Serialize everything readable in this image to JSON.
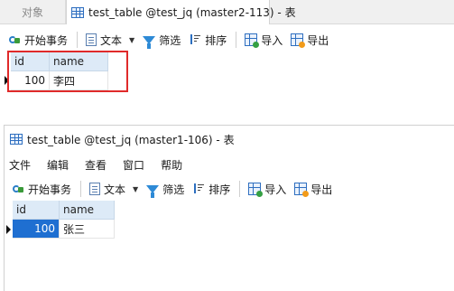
{
  "tabs": {
    "objects_label": "对象",
    "active_tab_label": "test_table @test_jq (master2-113) - 表"
  },
  "toolbar": {
    "begin_transaction": "开始事务",
    "text": "文本",
    "filter": "筛选",
    "sort": "排序",
    "import": "导入",
    "export": "导出"
  },
  "grid1": {
    "columns": [
      "id",
      "name"
    ],
    "rows": [
      [
        "100",
        "李四"
      ]
    ]
  },
  "window2": {
    "title": "test_table @test_jq (master1-106) - 表",
    "menu": [
      "文件",
      "编辑",
      "查看",
      "窗口",
      "帮助"
    ]
  },
  "grid2": {
    "columns": [
      "id",
      "name"
    ],
    "rows": [
      [
        "100",
        "张三"
      ]
    ]
  },
  "colors": {
    "highlight_border": "#e02a2a",
    "header_bg": "#ddeaf7",
    "selected_cell_bg": "#1f6fd1"
  }
}
